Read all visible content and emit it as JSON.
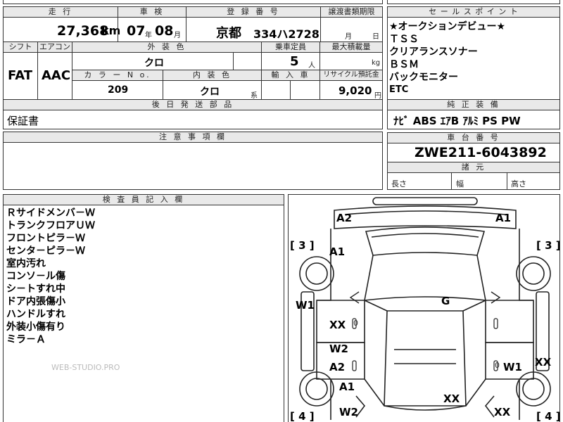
{
  "header": {
    "mileage_label": "走 行",
    "shaken_label": "車 検",
    "reg_label": "登 録 番 号",
    "transfer_label": "譲渡書類期限",
    "sales_label": "セ ー ル ス ポ イ ン ト",
    "mileage_value": "27,368",
    "mileage_unit": "km",
    "shaken_year": "07",
    "shaken_year_unit": "年",
    "shaken_month": "08",
    "shaken_month_unit": "月",
    "reg_area": "京都",
    "reg_number": "334ハ2728",
    "transfer_month_unit": "月",
    "transfer_day_unit": "日"
  },
  "specs": {
    "shift_label": "シフト",
    "ac_label": "エアコン",
    "ext_color_label": "外 装 色",
    "capacity_label": "乗車定員",
    "max_load_label": "最大積載量",
    "shift_value": "FAT",
    "ac_value": "AAC",
    "ext_color_value": "クロ",
    "capacity_value": "5",
    "capacity_unit": "人",
    "load_unit": "kg",
    "color_no_label": "カ ラ ー N o.",
    "int_color_label": "内 装 色",
    "import_label": "輸 入 車",
    "recycle_label": "リサイクル預託金",
    "color_no_value": "209",
    "int_color_value": "クロ",
    "int_color_unit": "系",
    "recycle_value": "9,020",
    "recycle_unit": "円"
  },
  "later_parts": {
    "label": "後 日 発 送 部 品",
    "value": "保証書"
  },
  "notes": {
    "label": "注 意 事 項 欄"
  },
  "sales_points": {
    "items": [
      "★オークションデビュー★",
      "ＴＳＳ",
      "クリアランスソナー",
      "ＢＳＭ",
      "バックモニター",
      "ETC"
    ]
  },
  "standard_equipment": {
    "label": "純 正 装 備",
    "value": "ﾅﾋﾞ ABS ｴｱB ｱﾙﾐ PS PW"
  },
  "chassis": {
    "label": "車 台 番 号",
    "value": "ZWE211-6043892"
  },
  "dimensions": {
    "label": "諸 元",
    "length_label": "長さ",
    "width_label": "幅",
    "height_label": "高さ"
  },
  "inspector": {
    "label": "検 査 員 記 入 欄",
    "lines": [
      "Ｒサイドメンバ－Ｗ",
      "トランクフロアＵＷ",
      "フロントピラ－Ｗ",
      "センタ－ピラ－Ｗ",
      "室内汚れ",
      "コンソ－ル傷",
      "シ－トすれ中",
      "ドア内張傷小",
      "ハンドルすれ",
      "外装小傷有り",
      "ミラ－Ａ"
    ],
    "watermark": "WEB-STUDIO.PRO"
  },
  "diagram": {
    "marks": {
      "a2_left": "A2",
      "a1_right_top": "A1",
      "bracket_left_top": "[ 3 ]",
      "bracket_right_top": "[ 3 ]",
      "a1_left": "A1",
      "w1_left": "W1",
      "g": "G",
      "xx_left": "XX",
      "w2_left": "W2",
      "a2_left_low": "A2",
      "w1_right": "W1",
      "xx_right_edge": "XX",
      "a1_left_low": "A1",
      "xx_rear": "XX",
      "w2_left_low": "W2",
      "xx_right_low": "XX",
      "bracket_left_bottom": "[ 4 ]",
      "bracket_right_bottom": "[ 4 ]",
      "small_0a": "0",
      "small_0b": "0"
    }
  }
}
